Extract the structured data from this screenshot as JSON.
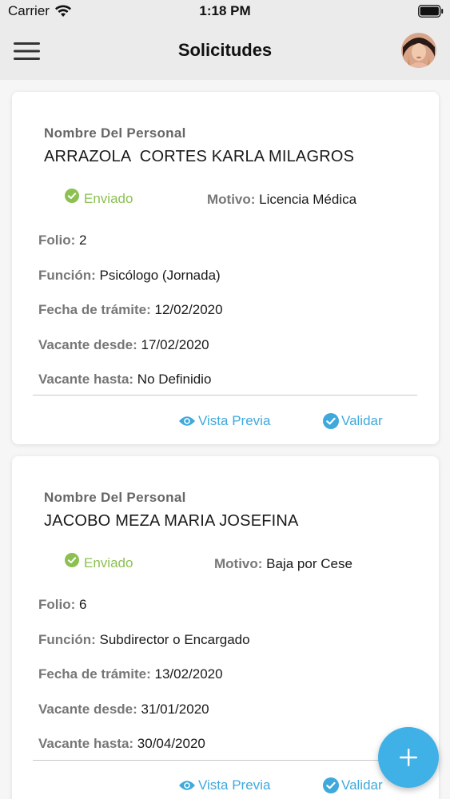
{
  "status_bar": {
    "carrier": "Carrier",
    "time": "1:18 PM"
  },
  "nav": {
    "title": "Solicitudes",
    "menu_icon": "hamburger-menu-icon",
    "avatar_icon": "user-avatar"
  },
  "labels": {
    "name_header": "Nombre Del Personal",
    "motivo": "Motivo:",
    "folio": "Folio:",
    "funcion": "Función:",
    "fecha_tramite": "Fecha de trámite:",
    "vacante_desde": "Vacante desde:",
    "vacante_hasta": "Vacante hasta:",
    "preview_action": "Vista Previa",
    "validate_action": "Validar"
  },
  "requests": [
    {
      "name": "ARRAZOLA  CORTES KARLA MILAGROS",
      "status": "Enviado",
      "motivo": "Licencia Médica",
      "folio": "2",
      "funcion": "Psicólogo (Jornada)",
      "fecha_tramite": "12/02/2020",
      "vacante_desde": "17/02/2020",
      "vacante_hasta": "No Definidio"
    },
    {
      "name": "JACOBO MEZA MARIA JOSEFINA",
      "status": "Enviado",
      "motivo": "Baja por Cese",
      "folio": "6",
      "funcion": "Subdirector o Encargado",
      "fecha_tramite": "13/02/2020",
      "vacante_desde": "31/01/2020",
      "vacante_hasta": "30/04/2020"
    }
  ],
  "fab": {
    "icon": "plus-icon"
  },
  "colors": {
    "accent": "#3fa9dc",
    "fab": "#3fb1e6",
    "status_sent": "#8cc152",
    "header_bg": "#ebebeb",
    "content_bg": "#f6f6f7"
  }
}
